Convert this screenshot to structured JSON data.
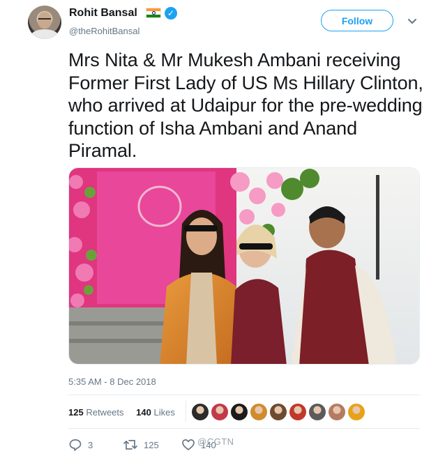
{
  "author": {
    "name": "Rohit Bansal",
    "handle": "@theRohitBansal",
    "avatar_icon": "profile-photo",
    "flag_icon": "india-flag-icon",
    "verified_icon": "verified-badge-icon"
  },
  "follow_button": {
    "label": "Follow"
  },
  "menu_icon": "chevron-down-icon",
  "tweet": {
    "text": "Mrs Nita & Mr Mukesh Ambani receiving Former First Lady of US Ms Hillary Clinton, who arrived at Udaipur for the pre-wedding function of Isha Ambani and Anand Piramal.",
    "timestamp": "5:35 AM - 8 Dec 2018"
  },
  "stats": {
    "retweets_count": "125",
    "retweets_label": "Retweets",
    "likes_count": "140",
    "likes_label": "Likes"
  },
  "liker_avatars": [
    {
      "name": "liker-1",
      "color": "#2b2b2b"
    },
    {
      "name": "liker-2",
      "color": "#c2394a"
    },
    {
      "name": "liker-3",
      "color": "#1b1b1b"
    },
    {
      "name": "liker-4",
      "color": "#d08b2c"
    },
    {
      "name": "liker-5",
      "color": "#6e4a2f"
    },
    {
      "name": "liker-6",
      "color": "#c0392b"
    },
    {
      "name": "liker-7",
      "color": "#5b5b5b"
    },
    {
      "name": "liker-8",
      "color": "#b57b62"
    },
    {
      "name": "liker-9",
      "color": "#e8a21a"
    }
  ],
  "actions": {
    "reply_count": "3",
    "retweet_count": "125",
    "like_count": "140"
  },
  "watermark": "@CGTN",
  "colors": {
    "accent": "#1da1f2",
    "text": "#14171a",
    "muted": "#657786",
    "divider": "#e6ecf0"
  }
}
